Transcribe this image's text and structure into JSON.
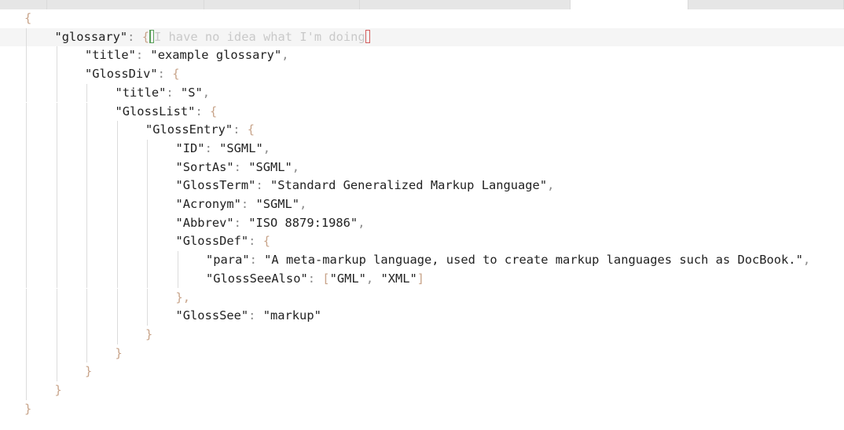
{
  "editor": {
    "ghost_text": "I have no idea what I'm doing",
    "lines": [
      {
        "key": "",
        "val": "",
        "open": "{",
        "close": ""
      },
      {
        "key": "\"glossary\"",
        "val": "",
        "open": "{",
        "close": ""
      },
      {
        "key": "\"title\"",
        "val": "\"example glossary\"",
        "open": "",
        "close": ","
      },
      {
        "key": "\"GlossDiv\"",
        "val": "",
        "open": "{",
        "close": ""
      },
      {
        "key": "\"title\"",
        "val": "\"S\"",
        "open": "",
        "close": ","
      },
      {
        "key": "\"GlossList\"",
        "val": "",
        "open": "{",
        "close": ""
      },
      {
        "key": "\"GlossEntry\"",
        "val": "",
        "open": "{",
        "close": ""
      },
      {
        "key": "\"ID\"",
        "val": "\"SGML\"",
        "open": "",
        "close": ","
      },
      {
        "key": "\"SortAs\"",
        "val": "\"SGML\"",
        "open": "",
        "close": ","
      },
      {
        "key": "\"GlossTerm\"",
        "val": "\"Standard Generalized Markup Language\"",
        "open": "",
        "close": ","
      },
      {
        "key": "\"Acronym\"",
        "val": "\"SGML\"",
        "open": "",
        "close": ","
      },
      {
        "key": "\"Abbrev\"",
        "val": "\"ISO 8879:1986\"",
        "open": "",
        "close": ","
      },
      {
        "key": "\"GlossDef\"",
        "val": "",
        "open": "{",
        "close": ""
      },
      {
        "key": "\"para\"",
        "val": "\"A meta-markup language, used to create markup languages such as DocBook.\"",
        "open": "",
        "close": ","
      },
      {
        "key": "\"GlossSeeAlso\"",
        "val": "",
        "open": "",
        "close": "",
        "array": [
          "\"GML\"",
          "\"XML\""
        ]
      },
      {
        "key": "",
        "val": "",
        "open": "",
        "close": "},"
      },
      {
        "key": "\"GlossSee\"",
        "val": "\"markup\"",
        "open": "",
        "close": ""
      },
      {
        "key": "",
        "val": "",
        "open": "",
        "close": "}"
      },
      {
        "key": "",
        "val": "",
        "open": "",
        "close": "}"
      },
      {
        "key": "",
        "val": "",
        "open": "",
        "close": "}"
      },
      {
        "key": "",
        "val": "",
        "open": "",
        "close": "}"
      },
      {
        "key": "",
        "val": "",
        "open": "",
        "close": "}"
      }
    ]
  }
}
